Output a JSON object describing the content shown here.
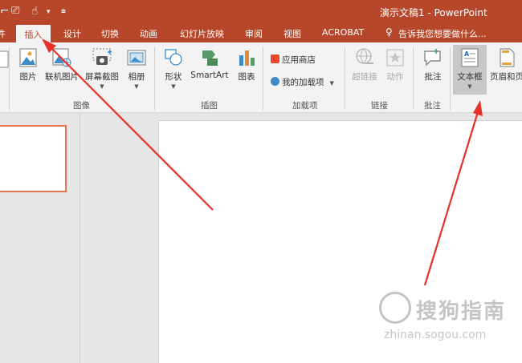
{
  "window": {
    "title": "演示文稿1 - PowerPoint",
    "brand_color": "#b7472a"
  },
  "quick_access": {
    "left_edge_icon": "partial-icon",
    "layout_icon": "layout-icon",
    "touch_icon": "touch-mode-icon",
    "dropdown_icon": "dropdown-arrow-icon",
    "customize_icon": "customize-icon"
  },
  "tabs": {
    "partial": "件",
    "insert": "插入",
    "design": "设计",
    "transitions": "切换",
    "animations": "动画",
    "slideshow": "幻灯片放映",
    "review": "审阅",
    "view": "视图",
    "acrobat": "ACROBAT",
    "tell_me": "告诉我您想要做什么..."
  },
  "ribbon": {
    "images": {
      "picture": "图片",
      "online_picture": "联机图片",
      "screenshot": "屏幕截图",
      "album": "相册",
      "group_label": "图像"
    },
    "illustrations": {
      "shapes": "形状",
      "smartart": "SmartArt",
      "chart": "图表",
      "group_label": "插图"
    },
    "addins": {
      "store": "应用商店",
      "my_addins": "我的加载项",
      "group_label": "加载项"
    },
    "links": {
      "hyperlink": "超链接",
      "action": "动作",
      "group_label": "链接"
    },
    "comments": {
      "comment": "批注",
      "group_label": "批注"
    },
    "text": {
      "textbox": "文本框",
      "header_footer": "页眉和页"
    }
  },
  "watermark": {
    "name": "搜狗指南",
    "url": "zhinan.sogou.com"
  },
  "annotation_color": "#e8312a"
}
